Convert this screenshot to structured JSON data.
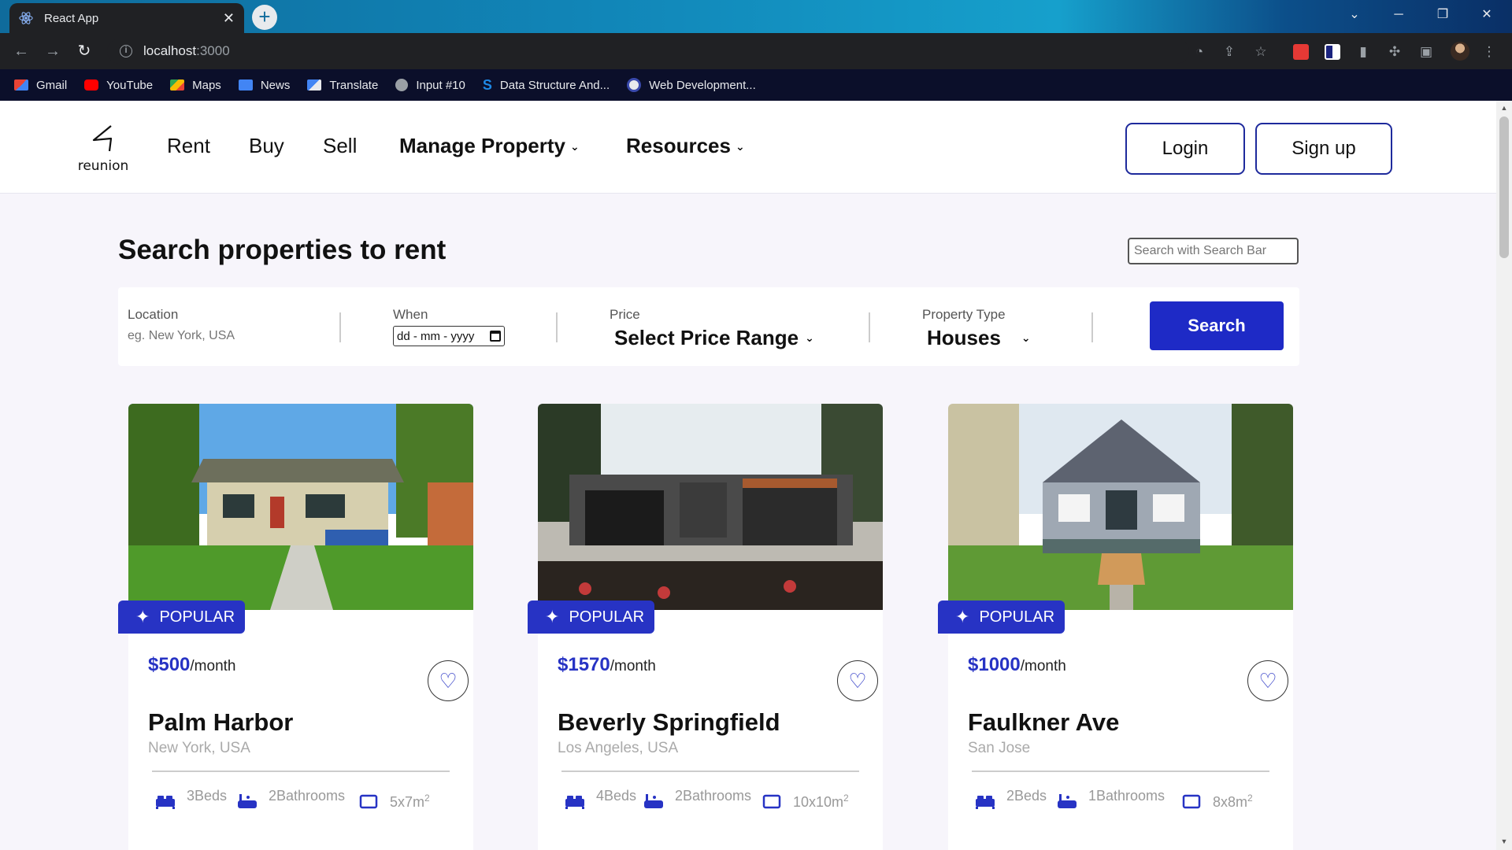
{
  "browser": {
    "tab_title": "React App",
    "tab_close": "✕",
    "new_tab": "+",
    "url_host": "localhost",
    "url_port": ":3000",
    "bookmarks": [
      {
        "label": "Gmail",
        "icon": "gmail-icon",
        "color": "#ea4335"
      },
      {
        "label": "YouTube",
        "icon": "youtube-icon",
        "color": "#ff0000"
      },
      {
        "label": "Maps",
        "icon": "maps-icon",
        "color": "#34a853"
      },
      {
        "label": "News",
        "icon": "news-icon",
        "color": "#4285f4"
      },
      {
        "label": "Translate",
        "icon": "translate-icon",
        "color": "#4285f4"
      },
      {
        "label": "Input #10",
        "icon": "globe-icon",
        "color": "#9aa0a6"
      },
      {
        "label": "Data Structure And...",
        "icon": "s-icon",
        "color": "#1e88e5"
      },
      {
        "label": "Web Development...",
        "icon": "web-icon",
        "color": "#e8eaed"
      }
    ]
  },
  "header": {
    "logo_text": "reunion",
    "nav": {
      "rent": "Rent",
      "buy": "Buy",
      "sell": "Sell",
      "manage_property": "Manage Property",
      "resources": "Resources"
    },
    "login": "Login",
    "signup": "Sign up"
  },
  "main": {
    "title": "Search properties to rent",
    "search_placeholder": "Search with Search Bar"
  },
  "filters": {
    "location_label": "Location",
    "location_placeholder": "eg. New York, USA",
    "when_label": "When",
    "date_placeholder": "dd - mm - yyyy",
    "price_label": "Price",
    "price_value": "Select Price Range",
    "type_label": "Property Type",
    "type_value": "Houses",
    "search_button": "Search"
  },
  "listings": [
    {
      "badge": "POPULAR",
      "price": "$500",
      "period": "/month",
      "name": "Palm Harbor",
      "location": "New York, USA",
      "beds": "3Beds",
      "baths": "2Bathrooms",
      "area": "5x7m",
      "area_unit_exp": "2"
    },
    {
      "badge": "POPULAR",
      "price": "$1570",
      "period": "/month",
      "name": "Beverly Springfield",
      "location": "Los Angeles, USA",
      "beds": "4Beds",
      "baths": "2Bathrooms",
      "area": "10x10m",
      "area_unit_exp": "2"
    },
    {
      "badge": "POPULAR",
      "price": "$1000",
      "period": "/month",
      "name": "Faulkner Ave",
      "location": "San Jose",
      "beds": "2Beds",
      "baths": "1Bathrooms",
      "area": "8x8m",
      "area_unit_exp": "2"
    }
  ],
  "colors": {
    "accent": "#2733c4",
    "button_border": "#1e2a9c",
    "page_bg": "#f7f5fb"
  }
}
